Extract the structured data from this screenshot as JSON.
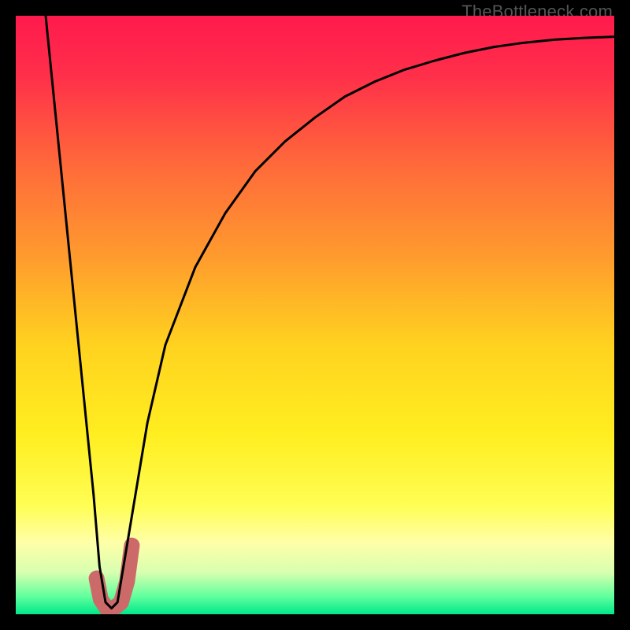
{
  "watermark": {
    "text": "TheBottleneck.com"
  },
  "colors": {
    "frame": "#000000",
    "curve": "#000000",
    "highlight": "#cc6a6a",
    "gradient_stops": [
      {
        "offset": 0.0,
        "color": "#ff1a4d"
      },
      {
        "offset": 0.1,
        "color": "#ff2f4a"
      },
      {
        "offset": 0.25,
        "color": "#ff6a3a"
      },
      {
        "offset": 0.4,
        "color": "#ff9a2e"
      },
      {
        "offset": 0.55,
        "color": "#ffd21f"
      },
      {
        "offset": 0.7,
        "color": "#ffee20"
      },
      {
        "offset": 0.82,
        "color": "#fffe55"
      },
      {
        "offset": 0.88,
        "color": "#ffffa8"
      },
      {
        "offset": 0.93,
        "color": "#d8ffb0"
      },
      {
        "offset": 0.97,
        "color": "#62ff9d"
      },
      {
        "offset": 1.0,
        "color": "#00e88a"
      }
    ]
  },
  "chart_data": {
    "type": "line",
    "title": "",
    "xlabel": "",
    "ylabel": "",
    "xlim": [
      0,
      100
    ],
    "ylim": [
      0,
      100
    ],
    "note": "x/y units are estimated percentages of the plot area (0=left/bottom, 100=right/top). Curve values read from pixels.",
    "series": [
      {
        "name": "bottleneck-curve",
        "x": [
          5,
          7,
          9,
          11,
          13,
          14,
          15,
          16,
          17,
          18,
          20,
          22,
          25,
          30,
          35,
          40,
          45,
          50,
          55,
          60,
          65,
          70,
          75,
          80,
          85,
          90,
          95,
          100
        ],
        "y": [
          100,
          80,
          60,
          40,
          20,
          8,
          2,
          1,
          2,
          8,
          20,
          32,
          45,
          58,
          67,
          74,
          79,
          83,
          86.5,
          89,
          91,
          92.5,
          93.8,
          94.8,
          95.5,
          96,
          96.3,
          96.5
        ]
      }
    ],
    "highlight": {
      "name": "optimal-region-marker",
      "shape": "J",
      "x": [
        13.5,
        14.2,
        15.2,
        16.4,
        17.6,
        18.6,
        19.4
      ],
      "y": [
        6.0,
        2.5,
        1.0,
        1.0,
        2.0,
        5.5,
        11.5
      ]
    }
  }
}
